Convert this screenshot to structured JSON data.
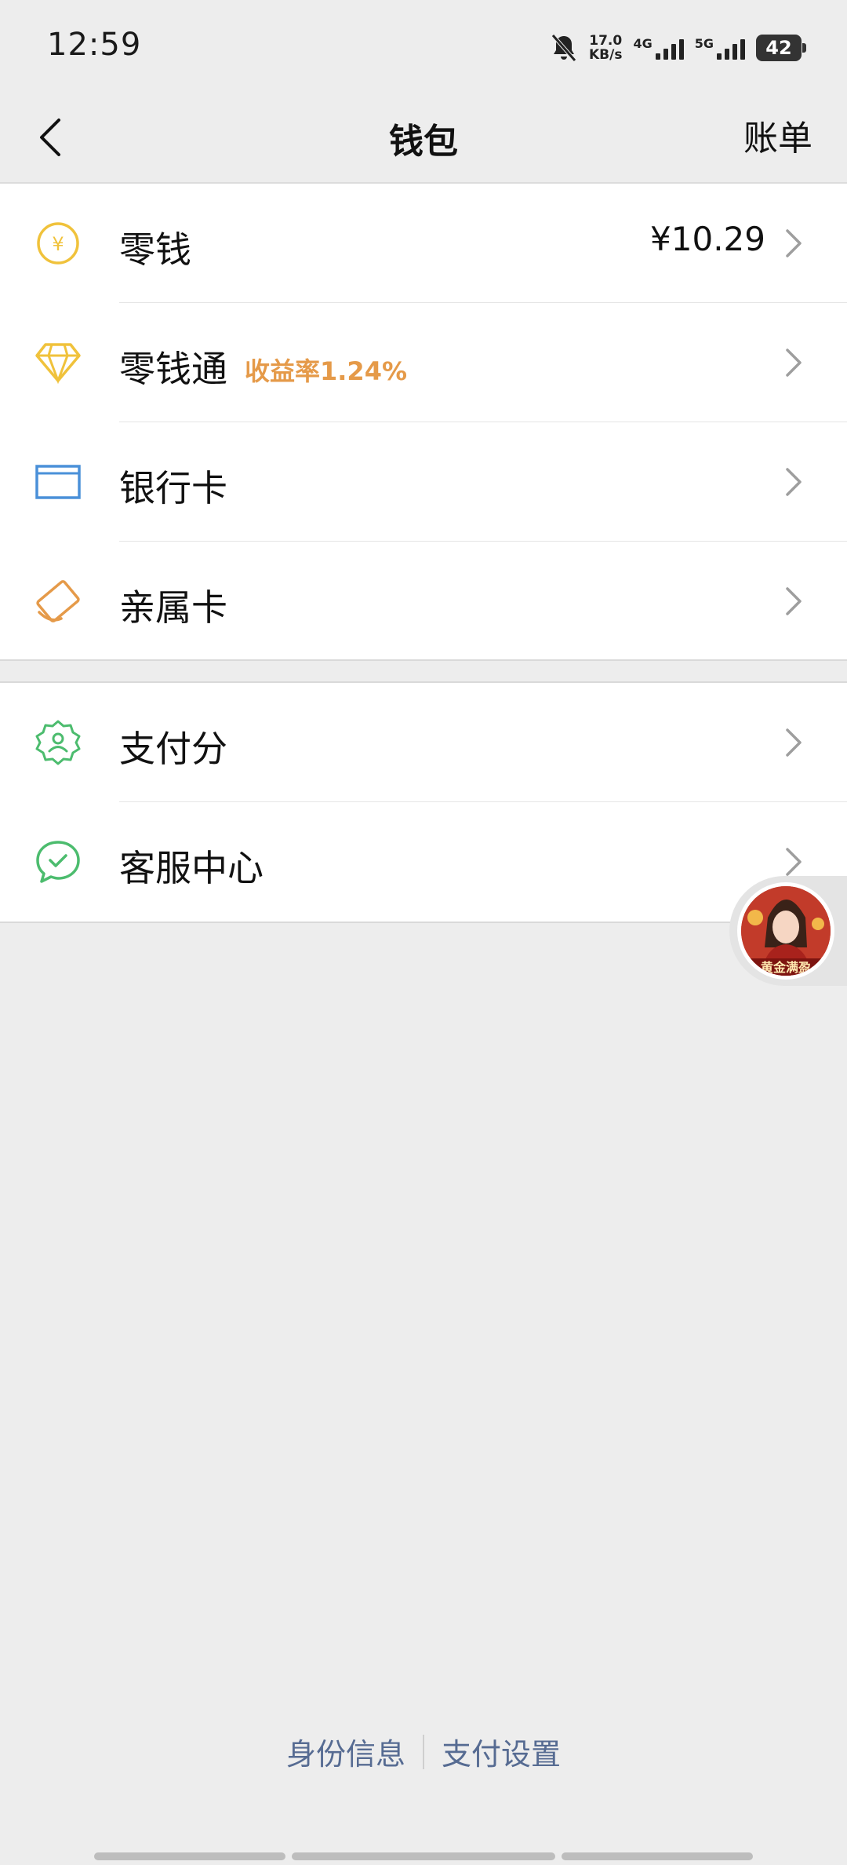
{
  "status": {
    "time": "12:59",
    "speed_value": "17.0",
    "speed_unit": "KB/s",
    "net1": "4G",
    "net2": "5G",
    "battery": "42"
  },
  "nav": {
    "title": "钱包",
    "right_action": "账单"
  },
  "wallet_items": [
    {
      "label": "零钱",
      "value": "¥10.29",
      "icon": "yuan-coin-icon",
      "color": "#f0c23b"
    },
    {
      "label": "零钱通",
      "badge": "收益率1.24%",
      "icon": "diamond-icon",
      "color": "#f0c23b"
    },
    {
      "label": "银行卡",
      "icon": "bank-card-icon",
      "color": "#4a90d9"
    },
    {
      "label": "亲属卡",
      "icon": "family-card-icon",
      "color": "#e59a49"
    }
  ],
  "service_items": [
    {
      "label": "支付分",
      "icon": "pay-score-icon",
      "color": "#4cbc6e"
    },
    {
      "label": "客服中心",
      "icon": "customer-service-icon",
      "color": "#4cbc6e"
    }
  ],
  "floating_widget": {
    "caption": "黄金满盈"
  },
  "footer": {
    "identity_link": "身份信息",
    "pay_settings_link": "支付设置"
  },
  "colors": {
    "badge": "#e59a49",
    "link": "#566b92",
    "background": "#ededed"
  }
}
